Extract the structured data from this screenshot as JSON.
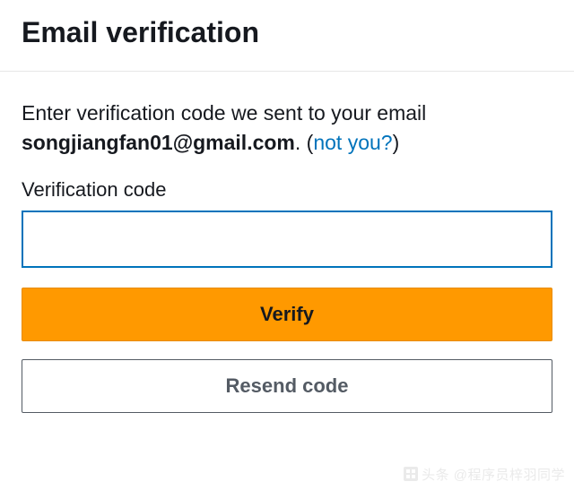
{
  "header": {
    "title": "Email verification"
  },
  "instruction": {
    "prefix": "Enter verification code we sent to your email ",
    "email": "songjiangfan01@gmail.com",
    "dot_open": ". (",
    "not_you": "not you?",
    "close": ")"
  },
  "field": {
    "label": "Verification code",
    "value": ""
  },
  "buttons": {
    "verify": "Verify",
    "resend": "Resend code"
  },
  "watermark": "头条 @程序员梓羽同学"
}
